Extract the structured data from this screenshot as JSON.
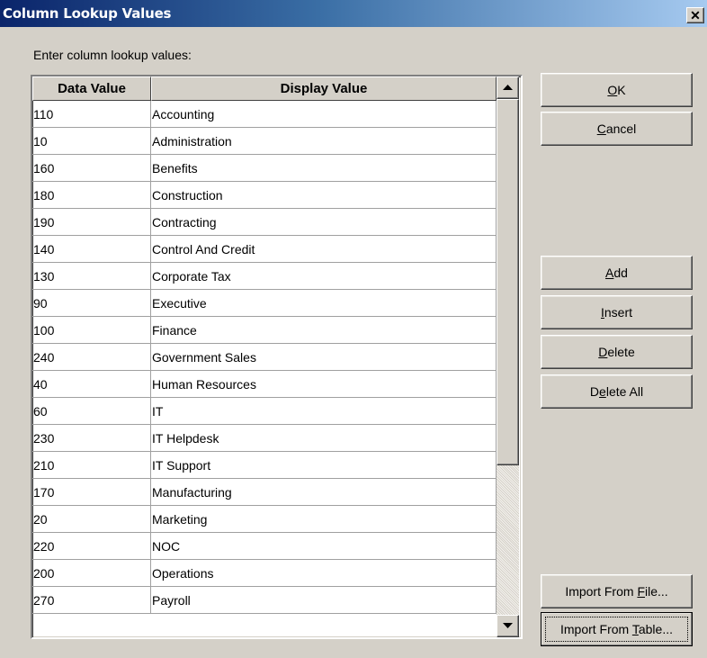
{
  "window": {
    "title": "Column Lookup Values",
    "close_glyph": "✕"
  },
  "prompt": "Enter column lookup values:",
  "grid": {
    "columns": [
      "Data Value",
      "Display Value"
    ],
    "rows": [
      [
        "110",
        "Accounting"
      ],
      [
        "10",
        "Administration"
      ],
      [
        "160",
        "Benefits"
      ],
      [
        "180",
        "Construction"
      ],
      [
        "190",
        "Contracting"
      ],
      [
        "140",
        "Control And Credit"
      ],
      [
        "130",
        "Corporate Tax"
      ],
      [
        "90",
        "Executive"
      ],
      [
        "100",
        "Finance"
      ],
      [
        "240",
        "Government Sales"
      ],
      [
        "40",
        "Human Resources"
      ],
      [
        "60",
        "IT"
      ],
      [
        "230",
        "IT Helpdesk"
      ],
      [
        "210",
        "IT Support"
      ],
      [
        "170",
        "Manufacturing"
      ],
      [
        "20",
        "Marketing"
      ],
      [
        "220",
        "NOC"
      ],
      [
        "200",
        "Operations"
      ],
      [
        "270",
        "Payroll"
      ]
    ]
  },
  "buttons": {
    "ok": {
      "pre": "",
      "acc": "O",
      "post": "K"
    },
    "cancel": {
      "pre": "",
      "acc": "C",
      "post": "ancel"
    },
    "add": {
      "pre": "",
      "acc": "A",
      "post": "dd"
    },
    "insert": {
      "pre": "",
      "acc": "I",
      "post": "nsert"
    },
    "delete": {
      "pre": "",
      "acc": "D",
      "post": "elete"
    },
    "delete_all": {
      "pre": "D",
      "acc": "e",
      "post": "lete All"
    },
    "import_file": {
      "pre": "Import From ",
      "acc": "F",
      "post": "ile..."
    },
    "import_table": {
      "pre": "Import From ",
      "acc": "T",
      "post": "able..."
    }
  },
  "icons": {
    "close": "close-icon",
    "scroll_up": "scroll-up-arrow-icon",
    "scroll_down": "scroll-down-arrow-icon"
  },
  "colors": {
    "title_start": "#0a246a",
    "title_end": "#a6caf0",
    "face": "#d4d0c8"
  }
}
